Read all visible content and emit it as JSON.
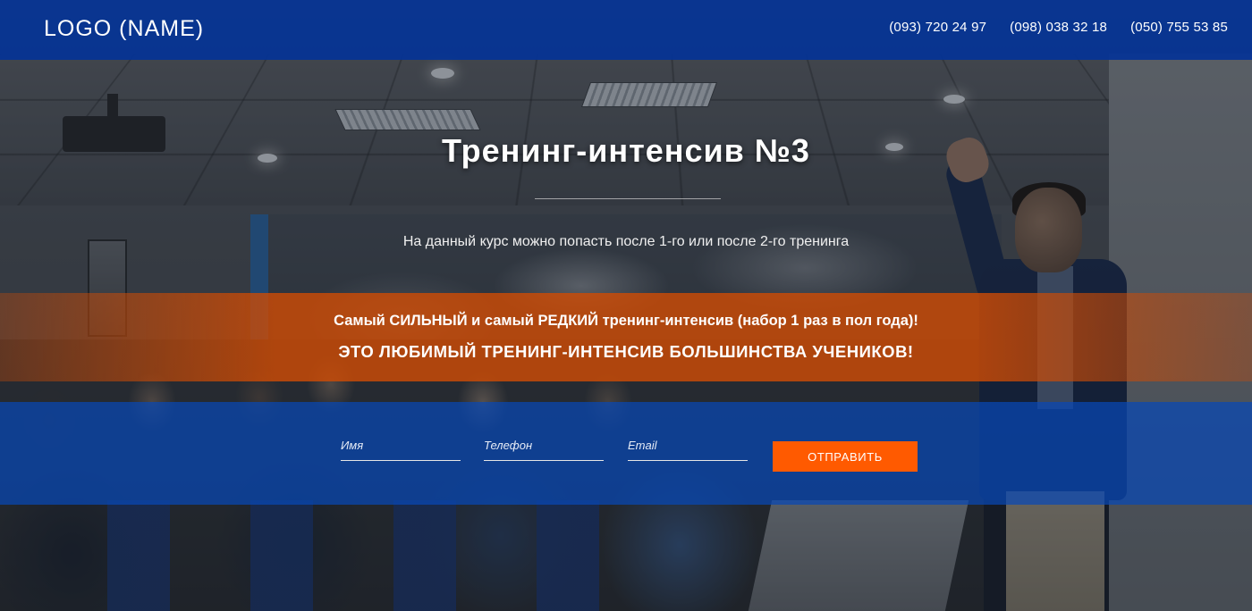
{
  "header": {
    "logo": "LOGO (NAME)",
    "phones": [
      "(093) 720 24 97",
      "(098) 038 32 18",
      "(050) 755 53 85"
    ]
  },
  "hero": {
    "title": "Тренинг-интенсив №3",
    "subtitle": "На данный курс можно попасть после 1-го или после 2-го тренинга",
    "promo_line1": "Самый СИЛЬНЫЙ и самый РЕДКИЙ тренинг-интенсив (набор 1 раз в пол года)!",
    "promo_line2": "ЭТО ЛЮБИМЫЙ ТРЕНИНГ-ИНТЕНСИВ БОЛЬШИНСТВА УЧЕНИКОВ!"
  },
  "form": {
    "name_placeholder": "Имя",
    "phone_placeholder": "Телефон",
    "email_placeholder": "Email",
    "submit_label": "ОТПРАВИТЬ"
  },
  "colors": {
    "header_bg": "#0534a0",
    "promo_bg": "#cd4b05",
    "form_band_bg": "#0848b6",
    "submit_bg": "#ff5a00"
  }
}
